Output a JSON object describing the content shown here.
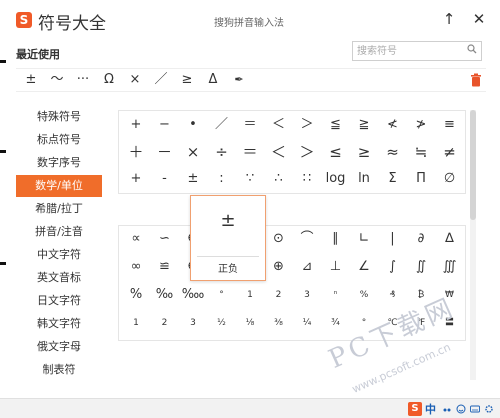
{
  "window": {
    "logo_glyph": "S",
    "title": "符号大全",
    "subtitle": "搜狗拼音输入法",
    "pin_glyph": "↑",
    "close_glyph": "✕"
  },
  "recent": {
    "label": "最近使用",
    "symbols": [
      "±",
      "～",
      "···",
      "Ω",
      "×",
      "／",
      "≥",
      "Δ",
      "✒"
    ]
  },
  "search": {
    "placeholder": "搜索符号"
  },
  "sidebar": {
    "items": [
      {
        "label": "特殊符号"
      },
      {
        "label": "标点符号"
      },
      {
        "label": "数字序号"
      },
      {
        "label": "数学/单位",
        "active": true
      },
      {
        "label": "希腊/拉丁"
      },
      {
        "label": "拼音/注音"
      },
      {
        "label": "中文字符"
      },
      {
        "label": "英文音标"
      },
      {
        "label": "日文字符"
      },
      {
        "label": "韩文字符"
      },
      {
        "label": "俄文字母"
      },
      {
        "label": "制表符"
      }
    ]
  },
  "grid": {
    "rows1": [
      [
        "+",
        "−",
        "•",
        "／",
        "＝",
        "＜",
        "＞",
        "≦",
        "≧",
        "≮",
        "≯",
        "≡"
      ],
      [
        "＋",
        "－",
        "×",
        "÷",
        "＝",
        "＜",
        "＞",
        "≤",
        "≥",
        "≈",
        "≒",
        "≠"
      ],
      [
        "+",
        "-",
        "±",
        ":",
        "∵",
        "∴",
        "∷",
        "log",
        "ln",
        "Σ",
        "Π",
        "∅"
      ]
    ],
    "rows2": [
      [
        "∝",
        "∽",
        "∈",
        "",
        "",
        "⊙",
        "⌒",
        "∥",
        "∟",
        "|",
        "∂",
        "∆"
      ],
      [
        "∞",
        "≌",
        "∉",
        "",
        "",
        "⊕",
        "⊿",
        "⊥",
        "∠",
        "∫",
        "∬",
        "∭"
      ],
      [
        "%",
        "‰",
        "‱",
        "°",
        "1",
        "2",
        "3",
        "ⁿ",
        "%",
        "₰",
        "₿",
        "₩"
      ],
      [
        "1",
        "2",
        "3",
        "½",
        "⅛",
        "⅜",
        "¼",
        "¾",
        "°",
        "℃",
        "℉",
        "〓"
      ]
    ]
  },
  "popup": {
    "symbol": "±",
    "name": "正负"
  },
  "watermark": {
    "big": "PC下载网",
    "url": "www.pcsoft.com.cn"
  },
  "statusbar": {
    "ime_logo": "S",
    "mode": "中"
  }
}
